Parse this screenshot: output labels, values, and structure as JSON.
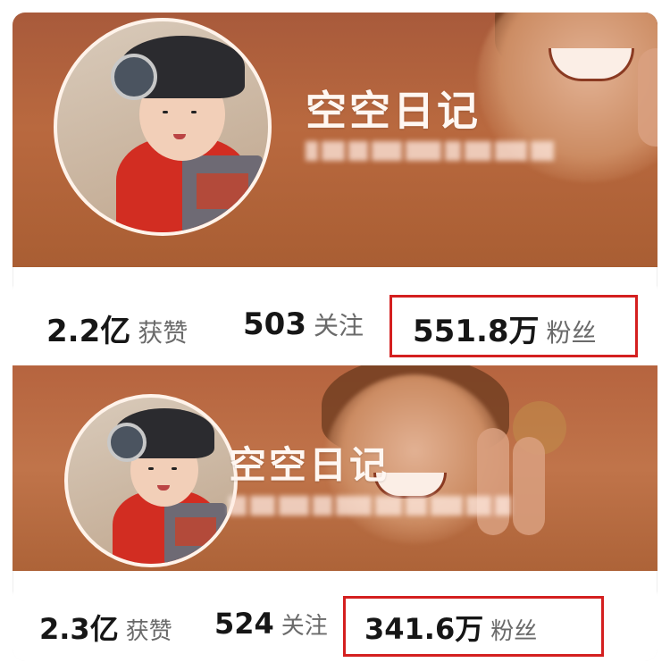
{
  "profiles": [
    {
      "nickname": "空空日记",
      "stats": [
        {
          "value": "2.2亿",
          "label": "获赞"
        },
        {
          "value": "503",
          "label": "关注"
        },
        {
          "value": "551.8万",
          "label": "粉丝"
        }
      ],
      "highlighted_stat": "粉丝"
    },
    {
      "nickname": "空空日记",
      "stats": [
        {
          "value": "2.3亿",
          "label": "获赞"
        },
        {
          "value": "524",
          "label": "关注"
        },
        {
          "value": "341.6万",
          "label": "粉丝"
        }
      ],
      "highlighted_stat": "粉丝"
    }
  ],
  "colors": {
    "banner": "#b0623b",
    "highlight_box": "#d41f1f",
    "stat_number": "#161616",
    "stat_label": "#6a6a6a"
  }
}
